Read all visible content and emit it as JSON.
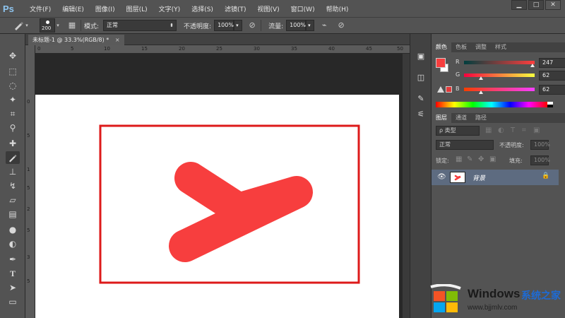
{
  "app": {
    "logo": "Ps"
  },
  "menu": [
    "文件(F)",
    "编辑(E)",
    "图像(I)",
    "图层(L)",
    "文字(Y)",
    "选择(S)",
    "滤镜(T)",
    "视图(V)",
    "窗口(W)",
    "帮助(H)"
  ],
  "window_buttons": {
    "minimize": "▁",
    "restore": "□",
    "close": "✕"
  },
  "options": {
    "brush_size": "200",
    "mode_label": "模式:",
    "mode_value": "正常",
    "opacity_label": "不透明度:",
    "opacity_value": "100%",
    "flow_label": "流量:",
    "flow_value": "100%"
  },
  "document": {
    "tab_title": "未标题-1 @ 33.3%(RGB/8) *",
    "close": "×"
  },
  "ruler_h_labels": [
    "0",
    "5",
    "10",
    "15",
    "20",
    "25",
    "30",
    "35",
    "40",
    "45",
    "50"
  ],
  "ruler_v_labels": [
    "0",
    "5",
    "1",
    "5",
    "2",
    "5",
    "3",
    "5"
  ],
  "color_panel": {
    "tabs": [
      "颜色",
      "色板",
      "调整",
      "样式"
    ],
    "r_label": "R",
    "r_value": "247",
    "g_label": "G",
    "g_value": "62",
    "b_label": "B",
    "b_value": "62",
    "r_level": 247,
    "g_level": 62,
    "b_level": 62,
    "foreground_color": "#f73e3e"
  },
  "layers_panel": {
    "tabs": [
      "图层",
      "通道",
      "路径"
    ],
    "filter_label": "ρ 类型",
    "blend_mode": "正常",
    "opacity_label": "不透明度:",
    "opacity_value": "100%",
    "lock_label": "锁定:",
    "fill_label": "填充:",
    "fill_value": "100%",
    "layer_name": "背景"
  },
  "colors": {
    "stroke": "#f73e3e",
    "rectangle": "#dd1a1a",
    "selected_layer": "#5d6b80"
  },
  "watermark": {
    "brand": "Windows",
    "brand_cn": "系统之家",
    "url": "www.bjjmlv.com"
  }
}
